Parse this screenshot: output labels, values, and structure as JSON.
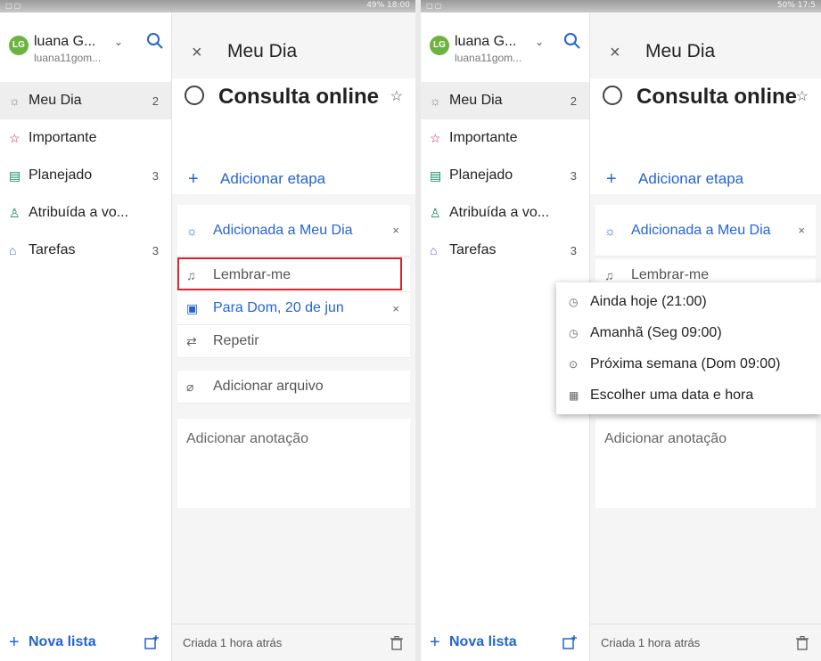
{
  "screens": [
    {
      "status": {
        "right": "49% 18:00"
      },
      "sidebar": {
        "avatar": "LG",
        "name": "luana G...",
        "email": "luana11gom...",
        "items": [
          {
            "label": "Meu Dia",
            "count": "2",
            "icon": "sun-icon"
          },
          {
            "label": "Importante",
            "count": "",
            "icon": "star-icon"
          },
          {
            "label": "Planejado",
            "count": "3",
            "icon": "calendar-icon"
          },
          {
            "label": "Atribuída a vo...",
            "count": "",
            "icon": "person-icon"
          },
          {
            "label": "Tarefas",
            "count": "3",
            "icon": "home-icon"
          }
        ],
        "new_list": "Nova lista"
      },
      "detail": {
        "header_title": "Meu Dia",
        "task_title": "Consulta online",
        "add_step": "Adicionar etapa",
        "added_my_day": "Adicionada a Meu Dia",
        "remind_me": "Lembrar-me",
        "due": "Para Dom, 20 de jun",
        "repeat": "Repetir",
        "add_file": "Adicionar arquivo",
        "add_note": "Adicionar anotação",
        "created": "Criada 1 hora atrás"
      }
    },
    {
      "status": {
        "right": "50% 17:5"
      },
      "sidebar": {
        "avatar": "LG",
        "name": "luana G...",
        "email": "luana11gom...",
        "items": [
          {
            "label": "Meu Dia",
            "count": "2",
            "icon": "sun-icon"
          },
          {
            "label": "Importante",
            "count": "",
            "icon": "star-icon"
          },
          {
            "label": "Planejado",
            "count": "3",
            "icon": "calendar-icon"
          },
          {
            "label": "Atribuída a vo...",
            "count": "",
            "icon": "person-icon"
          },
          {
            "label": "Tarefas",
            "count": "3",
            "icon": "home-icon"
          }
        ],
        "new_list": "Nova lista"
      },
      "detail": {
        "header_title": "Meu Dia",
        "task_title": "Consulta online",
        "add_step": "Adicionar etapa",
        "added_my_day": "Adicionada a Meu Dia",
        "remind_me": "Lembrar-me",
        "add_note": "Adicionar anotação",
        "created": "Criada 1 hora atrás"
      },
      "reminder_menu": [
        {
          "label": "Ainda hoje (21:00)",
          "icon": "clock-icon"
        },
        {
          "label": "Amanhã (Seg 09:00)",
          "icon": "clock-icon"
        },
        {
          "label": "Próxima semana (Dom 09:00)",
          "icon": "clock-forward-icon"
        },
        {
          "label": "Escolher uma data e hora",
          "icon": "calendar-clock-icon"
        }
      ]
    }
  ],
  "colors": {
    "accent": "#2564cf",
    "highlight": "#d9232d",
    "avatar": "#6db33f"
  }
}
